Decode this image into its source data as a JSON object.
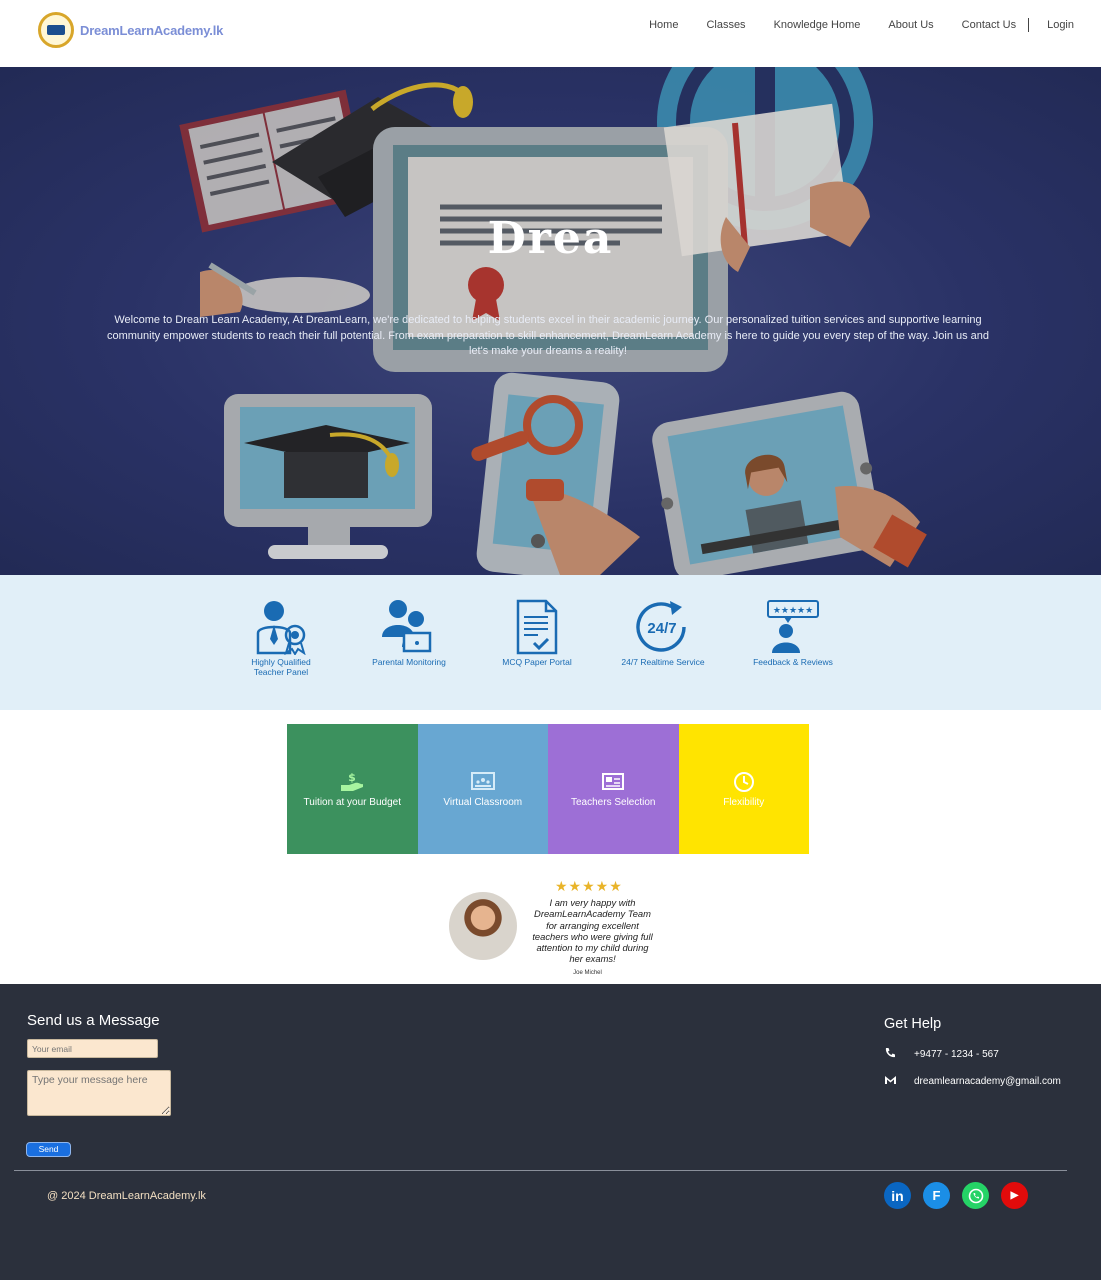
{
  "nav": {
    "logo_text": "DreamLearnAcademy.lk",
    "items": [
      "Home",
      "Classes",
      "Knowledge Home",
      "About Us",
      "Contact Us"
    ],
    "login": "Login"
  },
  "hero": {
    "title": "Drea",
    "text": "Welcome to Dream Learn Academy, At DreamLearn, we're dedicated to helping students excel in their academic journey. Our personalized tuition services and supportive learning community empower students to reach their full potential. From exam preparation to skill enhancement, DreamLearn Academy is here to guide you every step of the way. Join us and let's make your dreams a reality!"
  },
  "features": [
    {
      "icon": "teacher-icon",
      "label": "Highly Qualified Teacher Panel"
    },
    {
      "icon": "parent-icon",
      "label": "Parental Monitoring"
    },
    {
      "icon": "document-icon",
      "label": "MCQ Paper Portal"
    },
    {
      "icon": "clock-247-icon",
      "label": "24/7 Realtime Service"
    },
    {
      "icon": "review-icon",
      "label": "Feedback & Reviews"
    }
  ],
  "feature_icon_247": "24/7",
  "cards": [
    {
      "label": "Tuition at your Budget",
      "color": "#3c915e",
      "icon": "money-hand-icon"
    },
    {
      "label": "Virtual Classroom",
      "color": "#68a7d2",
      "icon": "classroom-icon"
    },
    {
      "label": "Teachers Selection",
      "color": "#9d6fd6",
      "icon": "id-card-icon"
    },
    {
      "label": "Flexibility",
      "color": "#ffe400",
      "icon": "clock-icon"
    }
  ],
  "testimonial": {
    "stars": "★★★★★",
    "quote": "I am very happy with DreamLearnAcademy Team for arranging excellent teachers who were giving full attention to my child during her exams!",
    "author": "Joe Michel"
  },
  "footer": {
    "form_title": "Send us a Message",
    "email_placeholder": "Your email",
    "message_placeholder": "Type your message here",
    "send_label": "Send",
    "help_title": "Get Help",
    "phone": "+9477 - 1234 - 567",
    "email": "dreamlearnacademy@gmail.com",
    "copyright": "@ 2024 DreamLearnAcademy.lk",
    "social": [
      {
        "icon": "linkedin-icon",
        "label": "in",
        "color": "#0a66c2"
      },
      {
        "icon": "facebook-icon",
        "label": "F",
        "color": "#1b8ee6"
      },
      {
        "icon": "whatsapp-icon",
        "label": "",
        "color": "#25d366"
      },
      {
        "icon": "youtube-icon",
        "label": "▶",
        "color": "#e20b0b"
      }
    ]
  }
}
